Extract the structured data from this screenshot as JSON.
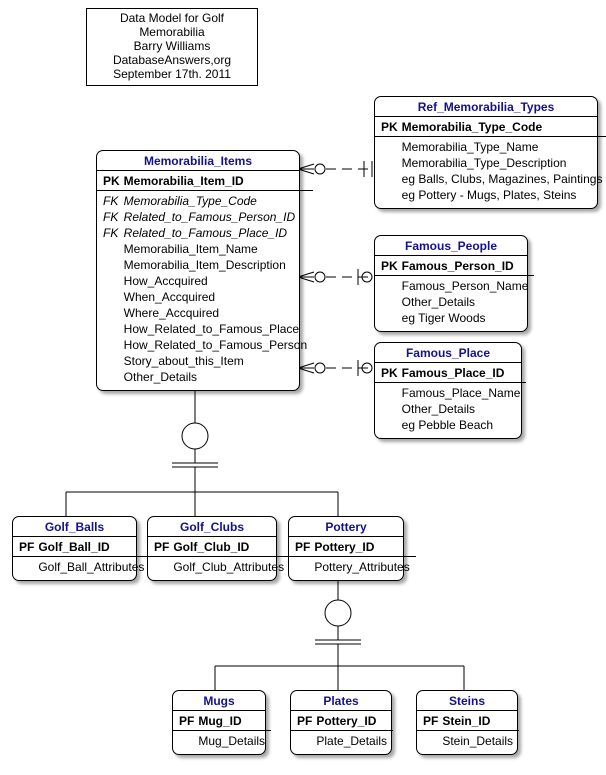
{
  "header": {
    "line1": "Data Model for Golf Memorabilia",
    "line2": "Barry Williams",
    "line3": "DatabaseAnswers,org",
    "line4": "September 17th. 2011"
  },
  "entities": {
    "memorabilia_items": {
      "title": "Memorabilia_Items",
      "rows": [
        {
          "key": "PK",
          "name": "Memorabilia_Item_ID",
          "ktype": "pk",
          "ntype": "pk"
        },
        {
          "key": "FK",
          "name": "Memorabilia_Type_Code",
          "ktype": "fk",
          "ntype": "fk"
        },
        {
          "key": "FK",
          "name": "Related_to_Famous_Person_ID",
          "ktype": "fk",
          "ntype": "fk"
        },
        {
          "key": "FK",
          "name": "Related_to_Famous_Place_ID",
          "ktype": "fk",
          "ntype": "fk"
        },
        {
          "key": "",
          "name": "Memorabilia_Item_Name",
          "ktype": "",
          "ntype": ""
        },
        {
          "key": "",
          "name": "Memorabilia_Item_Description",
          "ktype": "",
          "ntype": ""
        },
        {
          "key": "",
          "name": "How_Accquired",
          "ktype": "",
          "ntype": ""
        },
        {
          "key": "",
          "name": "When_Accquired",
          "ktype": "",
          "ntype": ""
        },
        {
          "key": "",
          "name": "Where_Accquired",
          "ktype": "",
          "ntype": ""
        },
        {
          "key": "",
          "name": "How_Related_to_Famous_Place",
          "ktype": "",
          "ntype": ""
        },
        {
          "key": "",
          "name": "How_Related_to_Famous_Person",
          "ktype": "",
          "ntype": ""
        },
        {
          "key": "",
          "name": "Story_about_this_Item",
          "ktype": "",
          "ntype": ""
        },
        {
          "key": "",
          "name": "Other_Details",
          "ktype": "",
          "ntype": ""
        }
      ]
    },
    "ref_types": {
      "title": "Ref_Memorabilia_Types",
      "rows": [
        {
          "key": "PK",
          "name": "Memorabilia_Type_Code",
          "ktype": "pk",
          "ntype": "pk"
        },
        {
          "key": "",
          "name": "Memorabilia_Type_Name",
          "ktype": "",
          "ntype": ""
        },
        {
          "key": "",
          "name": "Memorabilia_Type_Description",
          "ktype": "",
          "ntype": ""
        },
        {
          "key": "",
          "name": "eg Balls, Clubs, Magazines, Paintings",
          "ktype": "",
          "ntype": ""
        },
        {
          "key": "",
          "name": "eg Pottery - Mugs, Plates, Steins",
          "ktype": "",
          "ntype": ""
        }
      ]
    },
    "famous_people": {
      "title": "Famous_People",
      "rows": [
        {
          "key": "PK",
          "name": "Famous_Person_ID",
          "ktype": "pk",
          "ntype": "pk"
        },
        {
          "key": "",
          "name": "Famous_Person_Name",
          "ktype": "",
          "ntype": ""
        },
        {
          "key": "",
          "name": "Other_Details",
          "ktype": "",
          "ntype": ""
        },
        {
          "key": "",
          "name": "eg Tiger Woods",
          "ktype": "",
          "ntype": ""
        }
      ]
    },
    "famous_place": {
      "title": "Famous_Place",
      "rows": [
        {
          "key": "PK",
          "name": "Famous_Place_ID",
          "ktype": "pk",
          "ntype": "pk"
        },
        {
          "key": "",
          "name": "Famous_Place_Name",
          "ktype": "",
          "ntype": ""
        },
        {
          "key": "",
          "name": "Other_Details",
          "ktype": "",
          "ntype": ""
        },
        {
          "key": "",
          "name": "eg Pebble Beach",
          "ktype": "",
          "ntype": ""
        }
      ]
    },
    "golf_balls": {
      "title": "Golf_Balls",
      "rows": [
        {
          "key": "PF",
          "name": "Golf_Ball_ID",
          "ktype": "pk",
          "ntype": "pk"
        },
        {
          "key": "",
          "name": "Golf_Ball_Attributes",
          "ktype": "",
          "ntype": ""
        }
      ]
    },
    "golf_clubs": {
      "title": "Golf_Clubs",
      "rows": [
        {
          "key": "PF",
          "name": "Golf_Club_ID",
          "ktype": "pk",
          "ntype": "pk"
        },
        {
          "key": "",
          "name": "Golf_Club_Attributes",
          "ktype": "",
          "ntype": ""
        }
      ]
    },
    "pottery": {
      "title": "Pottery",
      "rows": [
        {
          "key": "PF",
          "name": "Pottery_ID",
          "ktype": "pk",
          "ntype": "pk"
        },
        {
          "key": "",
          "name": "Pottery_Attributes",
          "ktype": "",
          "ntype": ""
        }
      ]
    },
    "mugs": {
      "title": "Mugs",
      "rows": [
        {
          "key": "PF",
          "name": "Mug_ID",
          "ktype": "pk",
          "ntype": "pk"
        },
        {
          "key": "",
          "name": "Mug_Details",
          "ktype": "",
          "ntype": ""
        }
      ]
    },
    "plates": {
      "title": "Plates",
      "rows": [
        {
          "key": "PF",
          "name": "Pottery_ID",
          "ktype": "pk",
          "ntype": "pk"
        },
        {
          "key": "",
          "name": "Plate_Details",
          "ktype": "",
          "ntype": ""
        }
      ]
    },
    "steins": {
      "title": "Steins",
      "rows": [
        {
          "key": "PF",
          "name": "Stein_ID",
          "ktype": "pk",
          "ntype": "pk"
        },
        {
          "key": "",
          "name": "Stein_Details",
          "ktype": "",
          "ntype": ""
        }
      ]
    }
  }
}
